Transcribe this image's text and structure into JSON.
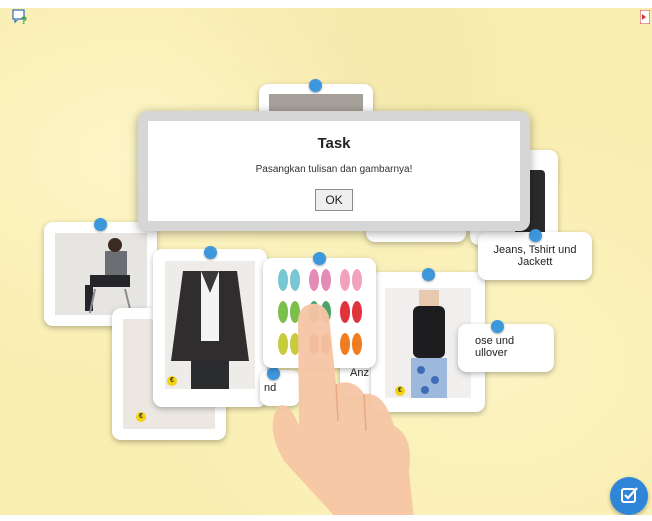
{
  "toolbar": {
    "help_icon": "help-icon",
    "fullscreen_icon": "fullscreen-icon"
  },
  "dialog": {
    "title": "Task",
    "message": "Pasangkan tulisan dan gambarnya!",
    "ok_label": "OK"
  },
  "labels": {
    "jeans": "Jeans, Tshirt und Jackett",
    "bluse": "ose und\nullover",
    "anz": "Anz",
    "und": "nd"
  },
  "badge": "€",
  "check_button": {
    "icon": "check-edit-icon"
  },
  "hint": {
    "icon": "pointing-hand-icon"
  },
  "colors": {
    "background": "#f9eeb0",
    "pin": "#3d97dc",
    "check_button": "#2f86d8",
    "badge": "#f3d10f"
  }
}
